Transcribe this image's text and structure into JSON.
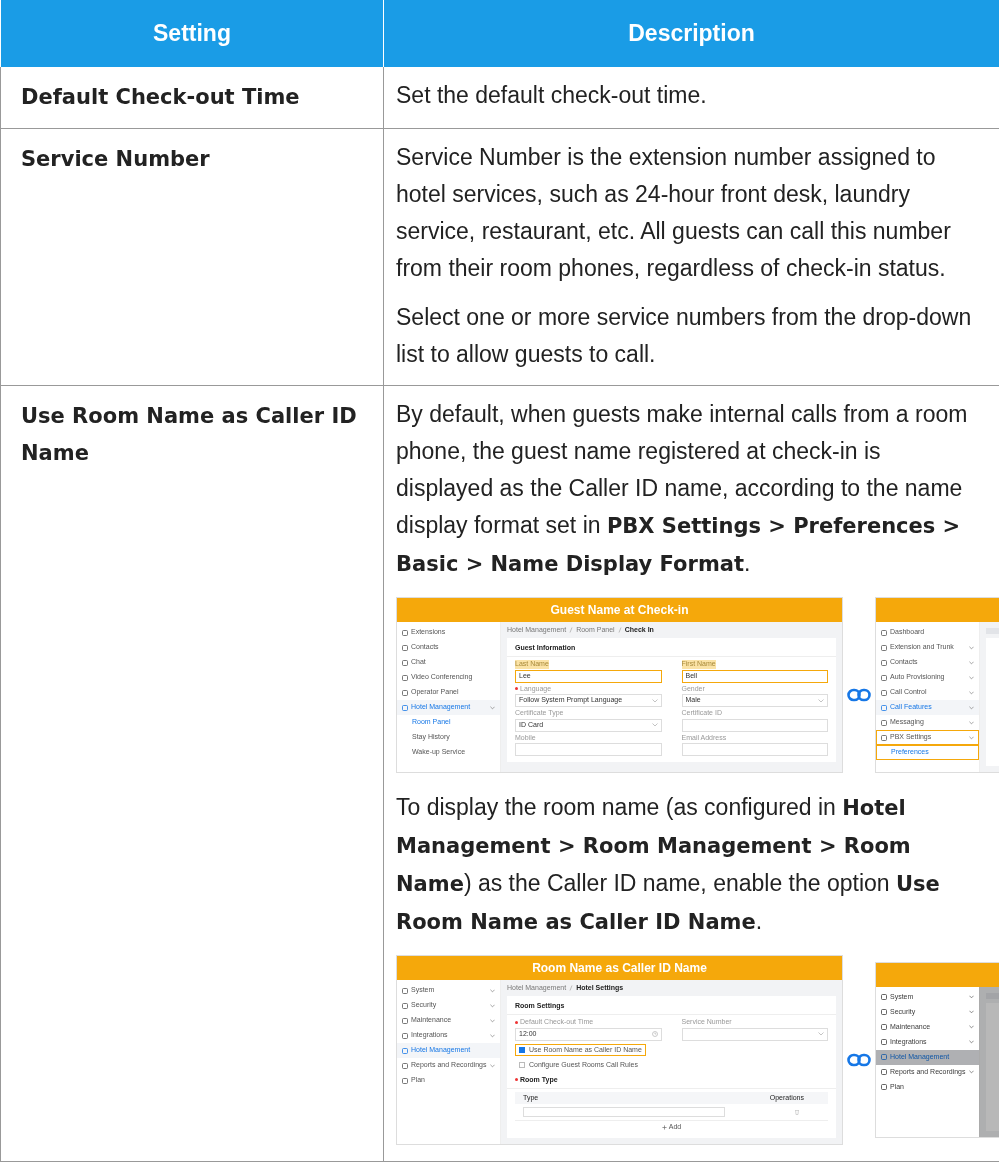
{
  "table": {
    "columns": [
      "Setting",
      "Description"
    ],
    "rows": [
      {
        "setting": "Default Check-out Time",
        "content": [
          {
            "kind": "paragraph",
            "text": "Set the default check-out time."
          }
        ]
      },
      {
        "setting": "Service Number",
        "content": [
          {
            "kind": "paragraph",
            "text": "Service Number is the extension number assigned to hotel services, such as 24-hour front desk, laundry service, restaurant, etc. All guests can call this number from their room phones, regardless of check-in status."
          },
          {
            "kind": "paragraph",
            "text": "Select one or more service numbers from the drop-down list to allow guests to call."
          }
        ]
      },
      {
        "setting": "Use Room Name as Caller ID Name",
        "content": [
          {
            "kind": "paragraph",
            "text": "By default, when guests make internal calls from a room phone, the guest name registered at check-in is displayed as the Caller ID name, according to the name display format set in **PBX Settings > Preferences > Basic > Name Display Format**."
          },
          {
            "kind": "figure",
            "screens": [
              {
                "kind": "full",
                "title": "Guest Name at Check-in",
                "dimmed": false,
                "sidebar": [
                  {
                    "label": "Extensions",
                    "kind": "item",
                    "expandable": false,
                    "selected": false,
                    "highlighted": false
                  },
                  {
                    "label": "Contacts",
                    "kind": "item",
                    "expandable": false,
                    "selected": false,
                    "highlighted": false
                  },
                  {
                    "label": "Chat",
                    "kind": "item",
                    "expandable": false,
                    "selected": false,
                    "highlighted": false
                  },
                  {
                    "label": "Video Conferencing",
                    "kind": "item",
                    "expandable": false,
                    "selected": false,
                    "highlighted": false
                  },
                  {
                    "label": "Operator Panel",
                    "kind": "item",
                    "expandable": false,
                    "selected": false,
                    "highlighted": false
                  },
                  {
                    "label": "Hotel Management",
                    "kind": "item",
                    "expandable": true,
                    "selected": true,
                    "highlighted": false
                  },
                  {
                    "label": "Room Panel",
                    "kind": "subitem",
                    "expandable": false,
                    "selected": true,
                    "highlighted": false
                  },
                  {
                    "label": "Stay History",
                    "kind": "subitem",
                    "expandable": false,
                    "selected": false,
                    "highlighted": false
                  },
                  {
                    "label": "Wake-up Service",
                    "kind": "subitem",
                    "expandable": false,
                    "selected": false,
                    "highlighted": false
                  }
                ],
                "breadcrumb": [
                  "Hotel Management",
                  "Room Panel",
                  "Check In"
                ],
                "blocks": [
                  {
                    "kind": "heading",
                    "text": "Guest Information",
                    "required": false
                  },
                  {
                    "kind": "fields",
                    "items": [
                      {
                        "label": "Last Name",
                        "value": "Lee",
                        "kind": "text",
                        "required": false,
                        "highlighted": true
                      },
                      {
                        "label": "First Name",
                        "value": "Bell",
                        "kind": "text",
                        "required": false,
                        "highlighted": true
                      },
                      {
                        "label": "Language",
                        "value": "Follow System Prompt Language",
                        "kind": "select",
                        "required": true,
                        "highlighted": false
                      },
                      {
                        "label": "Gender",
                        "value": "Male",
                        "kind": "select",
                        "required": false,
                        "highlighted": false
                      },
                      {
                        "label": "Certificate Type",
                        "value": "ID Card",
                        "kind": "select",
                        "required": false,
                        "highlighted": false
                      },
                      {
                        "label": "Certificate ID",
                        "kind": "text",
                        "required": false,
                        "highlighted": false
                      },
                      {
                        "label": "Mobile",
                        "kind": "text",
                        "required": false,
                        "highlighted": false
                      },
                      {
                        "label": "Email Address",
                        "kind": "text",
                        "required": false,
                        "highlighted": false
                      }
                    ]
                  }
                ]
              },
              {
                "kind": "partial",
                "dimmed": false,
                "sidebar": [
                  {
                    "label": "Dashboard",
                    "kind": "item",
                    "expandable": false,
                    "selected": false,
                    "highlighted": false
                  },
                  {
                    "label": "Extension and Trunk",
                    "kind": "item",
                    "expandable": true,
                    "selected": false,
                    "highlighted": false
                  },
                  {
                    "label": "Contacts",
                    "kind": "item",
                    "expandable": true,
                    "selected": false,
                    "highlighted": false
                  },
                  {
                    "label": "Auto Provisioning",
                    "kind": "item",
                    "expandable": true,
                    "selected": false,
                    "highlighted": false
                  },
                  {
                    "label": "Call Control",
                    "kind": "item",
                    "expandable": true,
                    "selected": false,
                    "highlighted": false
                  },
                  {
                    "label": "Call Features",
                    "kind": "item",
                    "expandable": true,
                    "selected": true,
                    "highlighted": false
                  },
                  {
                    "label": "Messaging",
                    "kind": "item",
                    "expandable": true,
                    "selected": false,
                    "highlighted": false
                  },
                  {
                    "label": "PBX Settings",
                    "kind": "item",
                    "expandable": true,
                    "selected": false,
                    "highlighted": true
                  },
                  {
                    "label": "Preferences",
                    "kind": "subitem",
                    "expandable": false,
                    "selected": true,
                    "highlighted": true
                  }
                ]
              }
            ]
          },
          {
            "kind": "paragraph",
            "text": "To display the room name (as configured in **Hotel Management > Room Management > Room Name**) as the Caller ID name, enable the option **Use Room Name as Caller ID Name**."
          },
          {
            "kind": "figure",
            "screens": [
              {
                "kind": "full",
                "title": "Room Name as Caller ID Name",
                "dimmed": false,
                "sidebar": [
                  {
                    "label": "System",
                    "kind": "item",
                    "expandable": true,
                    "selected": false,
                    "highlighted": false
                  },
                  {
                    "label": "Security",
                    "kind": "item",
                    "expandable": true,
                    "selected": false,
                    "highlighted": false
                  },
                  {
                    "label": "Maintenance",
                    "kind": "item",
                    "expandable": true,
                    "selected": false,
                    "highlighted": false
                  },
                  {
                    "label": "Integrations",
                    "kind": "item",
                    "expandable": true,
                    "selected": false,
                    "highlighted": false
                  },
                  {
                    "label": "Hotel Management",
                    "kind": "item",
                    "expandable": false,
                    "selected": true,
                    "highlighted": false
                  },
                  {
                    "label": "Reports and Recordings",
                    "kind": "item",
                    "expandable": true,
                    "selected": false,
                    "highlighted": false
                  },
                  {
                    "label": "Plan",
                    "kind": "item",
                    "expandable": false,
                    "selected": false,
                    "highlighted": false
                  }
                ],
                "breadcrumb": [
                  "Hotel Management",
                  "Hotel Settings"
                ],
                "blocks": [
                  {
                    "kind": "heading",
                    "text": "Room Settings",
                    "required": false
                  },
                  {
                    "kind": "fields",
                    "items": [
                      {
                        "label": "Default Check-out Time",
                        "value": "12:00",
                        "kind": "time",
                        "required": true,
                        "highlighted": false
                      },
                      {
                        "label": "Service Number",
                        "kind": "select",
                        "required": false,
                        "highlighted": false
                      }
                    ]
                  },
                  {
                    "kind": "checkbox",
                    "label": "Use Room Name as Caller ID Name",
                    "checked": true,
                    "highlighted": true
                  },
                  {
                    "kind": "checkbox",
                    "label": "Configure Guest Rooms Call Rules",
                    "checked": false,
                    "highlighted": false
                  },
                  {
                    "kind": "heading",
                    "text": "Room Type",
                    "required": true
                  },
                  {
                    "kind": "type-table",
                    "columns": [
                      "Type",
                      "Operations"
                    ],
                    "add_label": "Add"
                  }
                ]
              },
              {
                "kind": "partial",
                "dimmed": true,
                "sidebar": [
                  {
                    "label": "System",
                    "kind": "item",
                    "expandable": true,
                    "selected": false,
                    "highlighted": false
                  },
                  {
                    "label": "Security",
                    "kind": "item",
                    "expandable": true,
                    "selected": false,
                    "highlighted": false
                  },
                  {
                    "label": "Maintenance",
                    "kind": "item",
                    "expandable": true,
                    "selected": false,
                    "highlighted": false
                  },
                  {
                    "label": "Integrations",
                    "kind": "item",
                    "expandable": true,
                    "selected": false,
                    "highlighted": false
                  },
                  {
                    "label": "Hotel Management",
                    "kind": "item",
                    "expandable": false,
                    "selected": true,
                    "highlighted": false
                  },
                  {
                    "label": "Reports and Recordings",
                    "kind": "item",
                    "expandable": true,
                    "selected": false,
                    "highlighted": false
                  },
                  {
                    "label": "Plan",
                    "kind": "item",
                    "expandable": false,
                    "selected": false,
                    "highlighted": false
                  }
                ]
              }
            ]
          }
        ]
      }
    ]
  }
}
